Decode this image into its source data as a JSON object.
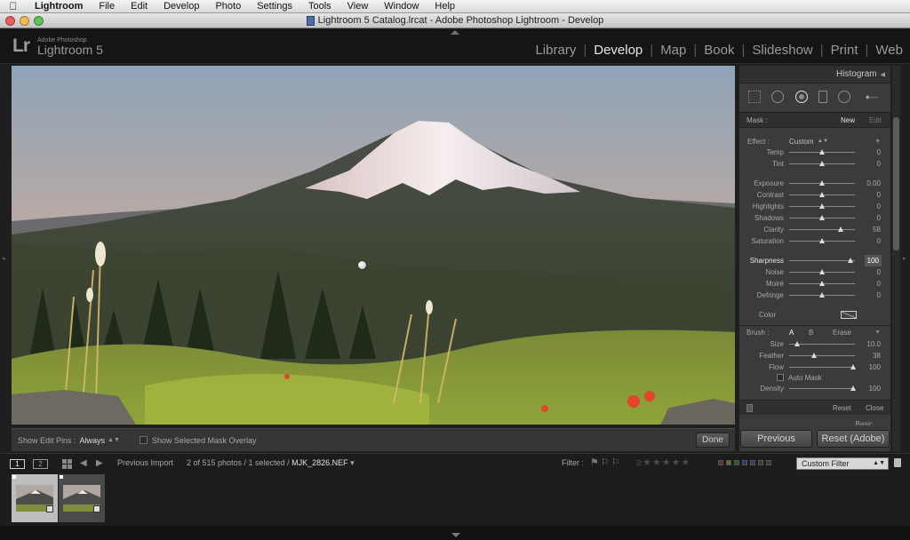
{
  "menubar": {
    "items": [
      "Lightroom",
      "File",
      "Edit",
      "Develop",
      "Photo",
      "Settings",
      "Tools",
      "View",
      "Window",
      "Help"
    ]
  },
  "window": {
    "title": "Lightroom 5 Catalog.lrcat - Adobe Photoshop Lightroom - Develop"
  },
  "logo": {
    "mark": "Lr",
    "small": "Adobe Photoshop",
    "big": "Lightroom 5"
  },
  "modules": [
    "Library",
    "Develop",
    "Map",
    "Book",
    "Slideshow",
    "Print",
    "Web"
  ],
  "active_module": "Develop",
  "toolbar": {
    "pins_label": "Show Edit Pins :",
    "pins_value": "Always",
    "overlay_label": "Show Selected Mask Overlay",
    "done": "Done"
  },
  "panel": {
    "histogram": "Histogram",
    "mask": {
      "label": "Mask :",
      "new": "New",
      "edit": "Edit"
    },
    "effect": {
      "label": "Effect :",
      "value": "Custom"
    },
    "sliders": [
      {
        "name": "Temp",
        "value": "0",
        "pos": 0.5
      },
      {
        "name": "Tint",
        "value": "0",
        "pos": 0.5
      },
      {
        "name": "Exposure",
        "value": "0.00",
        "pos": 0.5
      },
      {
        "name": "Contrast",
        "value": "0",
        "pos": 0.5
      },
      {
        "name": "Highlights",
        "value": "0",
        "pos": 0.5
      },
      {
        "name": "Shadows",
        "value": "0",
        "pos": 0.5
      },
      {
        "name": "Clarity",
        "value": "58",
        "pos": 0.79
      },
      {
        "name": "Saturation",
        "value": "0",
        "pos": 0.5
      },
      {
        "name": "Sharpness",
        "value": "100",
        "pos": 0.93
      },
      {
        "name": "Noise",
        "value": "0",
        "pos": 0.5
      },
      {
        "name": "Moiré",
        "value": "0",
        "pos": 0.5
      },
      {
        "name": "Defringe",
        "value": "0",
        "pos": 0.5
      }
    ],
    "color_label": "Color",
    "brush": {
      "label": "Brush :",
      "a": "A",
      "b": "B",
      "erase": "Erase"
    },
    "brush_sliders": [
      {
        "name": "Size",
        "value": "10.0",
        "pos": 0.12
      },
      {
        "name": "Feather",
        "value": "38",
        "pos": 0.38
      },
      {
        "name": "Flow",
        "value": "100",
        "pos": 0.97
      }
    ],
    "auto_mask": "Auto Mask",
    "density": {
      "name": "Density",
      "value": "100",
      "pos": 0.97
    },
    "reset": "Reset",
    "close": "Close",
    "basic": "Basic",
    "previous": "Previous",
    "reset_adobe": "Reset (Adobe)"
  },
  "filmstrip": {
    "mon1": "1",
    "mon2": "2",
    "source": "Previous Import",
    "count": "2 of 515 photos / 1 selected /",
    "filename": "MJK_2826.NEF",
    "filter_label": "Filter :",
    "custom_filter": "Custom Filter"
  },
  "colors": {
    "accent_active": "#e6e6e6",
    "panel_bg": "#3b3b3b",
    "header_bg": "#151515"
  }
}
